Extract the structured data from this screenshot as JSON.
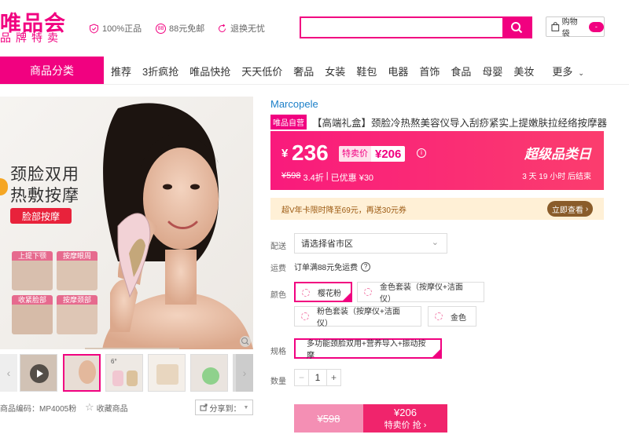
{
  "header": {
    "logo_main": "唯品会",
    "logo_sub": "品牌特卖",
    "promises": [
      {
        "icon": "shield-check-icon",
        "label": "100%正品"
      },
      {
        "icon": "free-shipping-88-icon",
        "badge": "88",
        "label": "88元免邮"
      },
      {
        "icon": "return-arrow-icon",
        "label": "退换无忧"
      }
    ],
    "search": {
      "placeholder": "",
      "value": ""
    },
    "cart": {
      "label": "购物袋",
      "badge": "-"
    }
  },
  "nav": {
    "category_label": "商品分类",
    "items": [
      "推荐",
      "3折疯抢",
      "唯品快抢",
      "天天低价",
      "奢品",
      "女装",
      "鞋包",
      "电器",
      "首饰",
      "食品",
      "母婴",
      "美妆",
      "更多"
    ]
  },
  "gallery": {
    "main_overlay": {
      "title_line1": "颈脸双用",
      "title_line2": "热敷按摩",
      "tag": "脸部按摩"
    },
    "feature_tags": [
      "上提下颚",
      "按摩眼周",
      "收紧脸部",
      "按摩颈部"
    ],
    "thumb_count": 6,
    "thumb2_text": "6°"
  },
  "meta": {
    "product_code": "商品编码：MP4005粉",
    "favorite_label": "收藏商品",
    "share_label": "分享到："
  },
  "product": {
    "brand": "Marcopele",
    "self_tag": "唯品自营",
    "title": "【高端礼盒】颈脸冷热熬美容仪导入刮痧紧实上提嫩肤拉经络按摩器",
    "price_symbol": "¥",
    "price": "236",
    "special_label": "特卖价",
    "special_price": "¥206",
    "original": "¥598",
    "discount": "3.4折",
    "saved": "已优惠 ¥30",
    "promo_name": "超级品类日",
    "countdown": "3 天 19 小时 后结束"
  },
  "promo_bar": {
    "text": "超V年卡限时降至69元，再送30元券",
    "button": "立即查看"
  },
  "delivery": {
    "label": "配送",
    "select_value": "请选择省市区"
  },
  "shipping": {
    "label": "运费",
    "text": "订单满88元免运费"
  },
  "color": {
    "label": "颜色",
    "options": [
      "樱花粉",
      "金色套装（按摩仪+洁面仪）",
      "粉色套装（按摩仪+洁面仪）",
      "金色"
    ],
    "selected_index": 0
  },
  "spec": {
    "label": "规格",
    "options": [
      "多功能颈脸双用+营养导入+振动按摩"
    ],
    "selected_index": 0
  },
  "quantity": {
    "label": "数量",
    "value": "1",
    "minus": "−",
    "plus": "+"
  },
  "buy": {
    "orig_price": "¥598",
    "price": "¥206",
    "action": "特卖价 抢"
  },
  "colors": {
    "brand_pink": "#f10180",
    "price_gradient_start": "#f91a7c",
    "link_blue": "#1b7fc8"
  }
}
